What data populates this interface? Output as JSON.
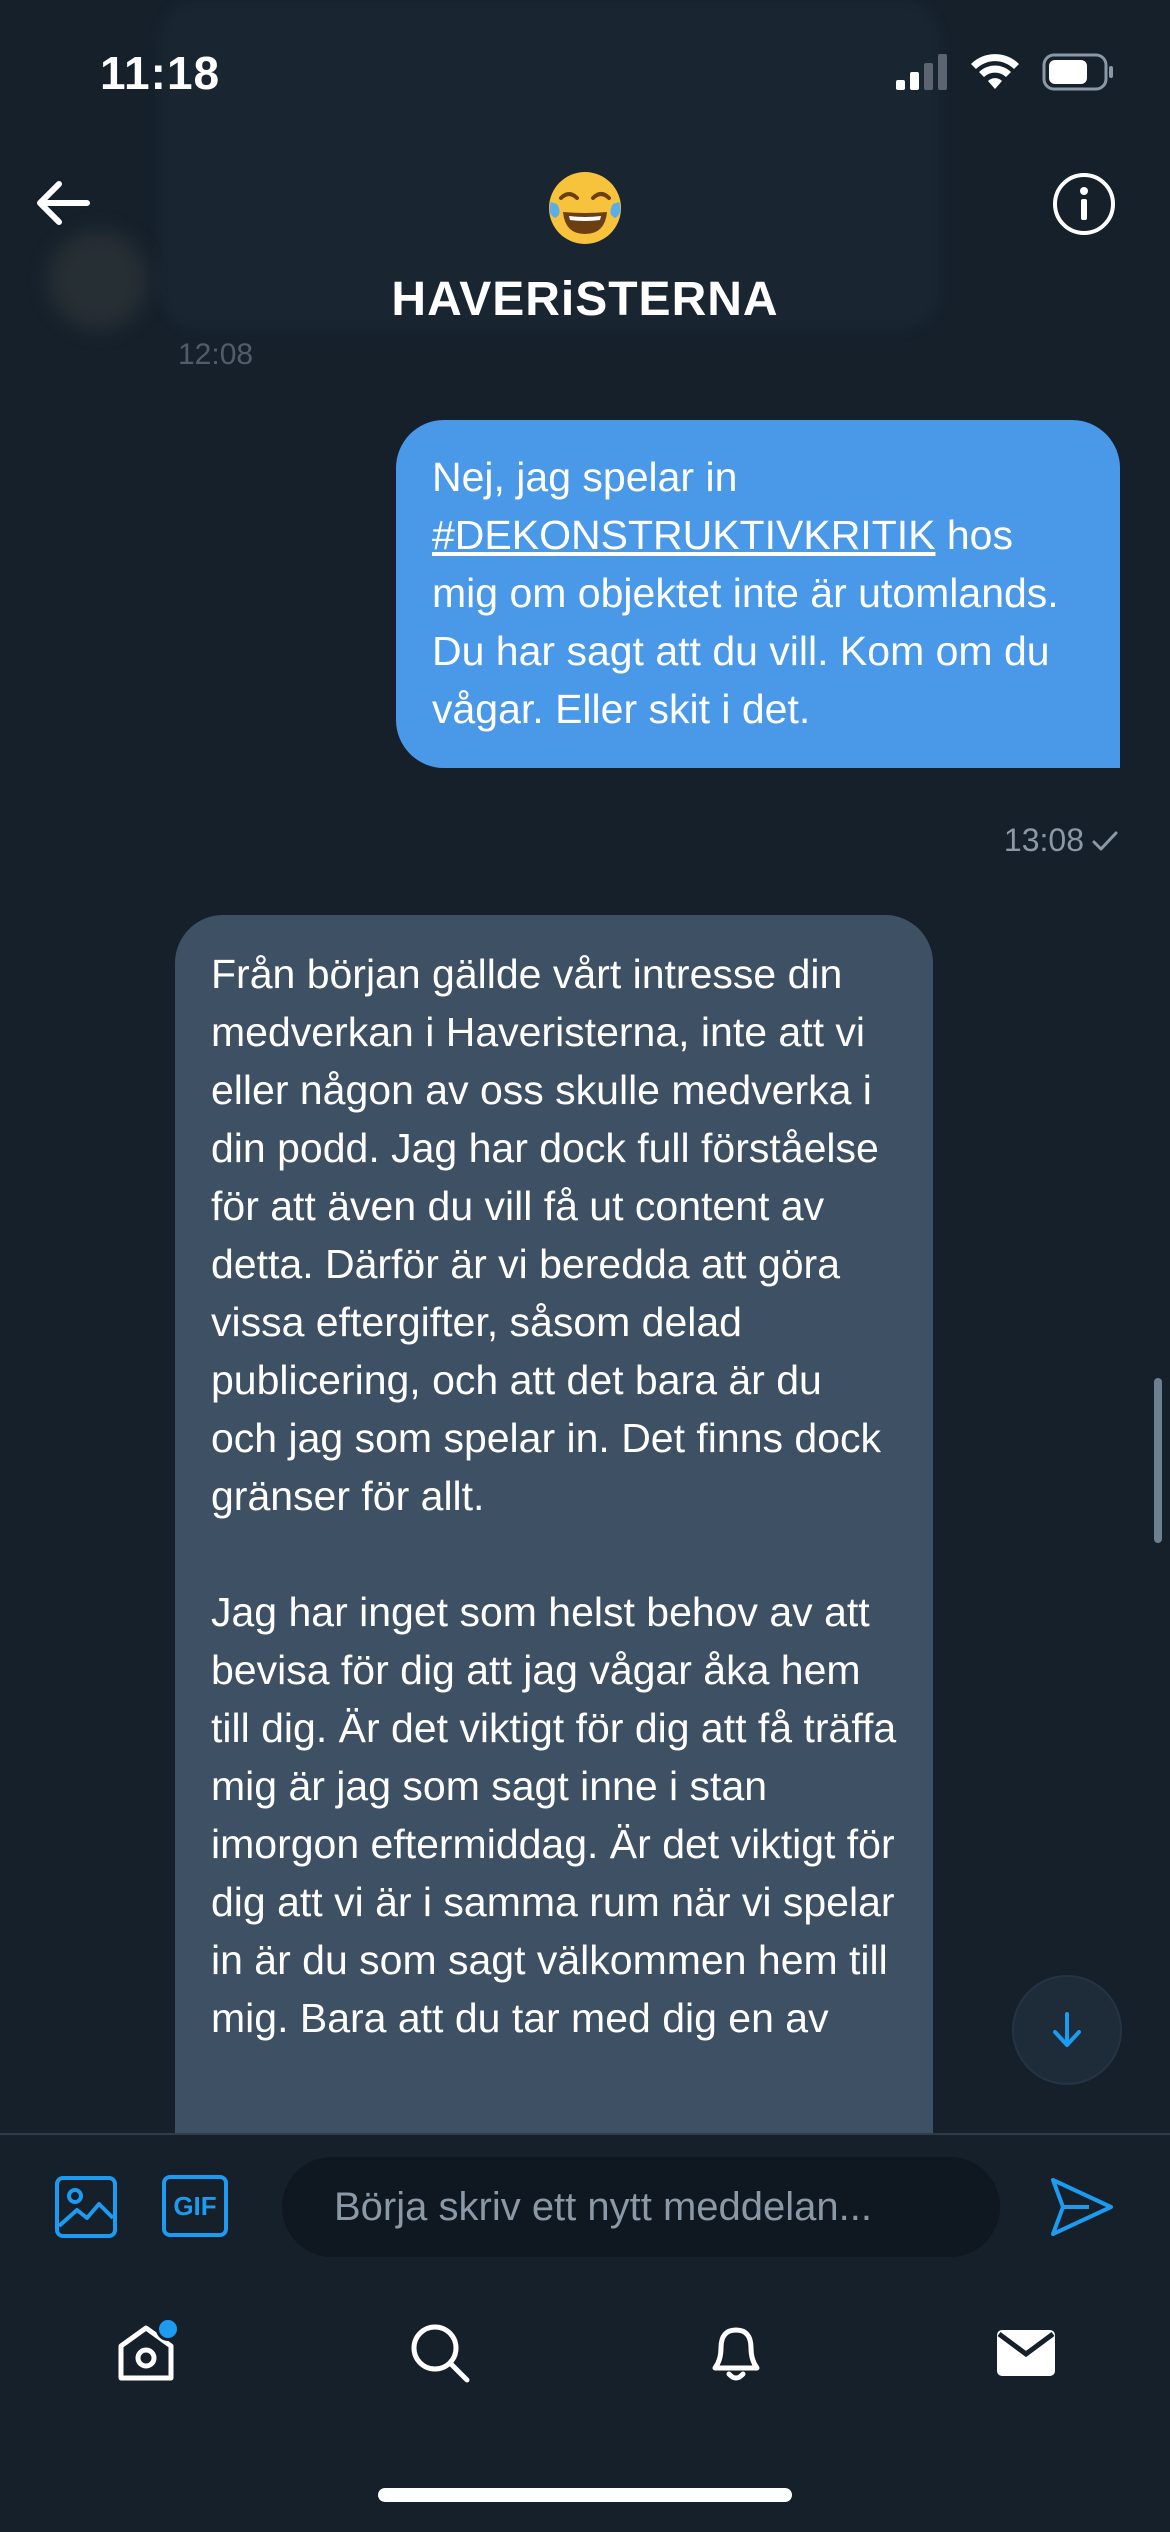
{
  "status_bar": {
    "time": "11:18"
  },
  "header": {
    "group_emoji": "😂",
    "group_name": "HAVERiSTERNA",
    "prev_time": "12:08"
  },
  "messages": {
    "outgoing": {
      "text_before": "Nej, jag spelar in ",
      "hashtag": "#DEKONSTRUKTIVKRITIK",
      "text_after": " hos mig om objektet inte är utomlands. Du har sagt att du vill. Kom om du vågar. Eller skit i det.",
      "time": "13:08",
      "status_icon": "check-icon"
    },
    "incoming": {
      "paragraph1": "Från början gällde vårt intresse din medverkan i Haveristerna, inte att vi eller någon av oss skulle medverka i din podd. Jag har dock full förståelse för att även du vill få ut content av detta. Därför är vi beredda att göra vissa eftergifter, såsom delad publicering, och att det bara är du och jag som spelar in. Det finns dock gränser för allt.",
      "paragraph2": "Jag har inget som helst behov av att bevisa för dig att jag vågar åka hem till dig. Är det viktigt för dig att få träffa mig är jag som sagt inne i stan imorgon eftermiddag. Är det viktigt för dig att vi är i samma rum när vi spelar in är du som sagt välkommen hem till mig. Bara att du tar med dig en av"
    }
  },
  "composer": {
    "gif_label": "GIF",
    "placeholder": "Börja skriv ett nytt meddelan..."
  },
  "icons": {
    "back": "arrow-left-icon",
    "info": "info-icon",
    "image": "image-icon",
    "send": "send-icon",
    "tabs": [
      "home-icon",
      "search-icon",
      "bell-icon",
      "mail-icon"
    ]
  },
  "colors": {
    "background": "#15202b",
    "accent": "#1d9bf0",
    "outgoing_bubble": "#4a99e9",
    "incoming_bubble": "#3e5063"
  }
}
